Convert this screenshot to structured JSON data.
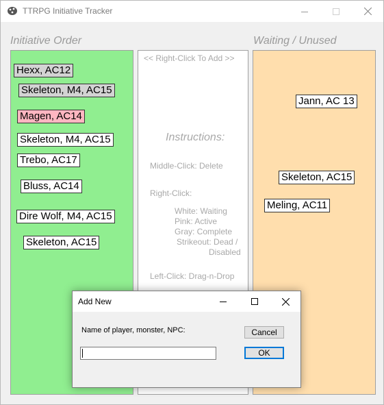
{
  "window": {
    "title": "TTRPG Initiative Tracker",
    "icon": "dice-icon",
    "controls": {
      "minimize": "minimize-icon",
      "maximize": "maximize-icon",
      "close": "close-icon"
    }
  },
  "sections": {
    "initiative_title": "Initiative Order",
    "waiting_title": "Waiting / Unused"
  },
  "initiative": {
    "entries": [
      {
        "label": "Hexx, AC12",
        "state": "Gray: Complete"
      },
      {
        "label": "Skeleton, M4, AC15",
        "state": "Gray: Complete"
      },
      {
        "label": "Magen, AC14",
        "state": "Pink: Active"
      },
      {
        "label": "Skeleton, M4, AC15",
        "state": "White: Waiting"
      },
      {
        "label": "Trebo, AC17",
        "state": "White: Waiting"
      },
      {
        "label": "Bluss, AC14",
        "state": "White: Waiting"
      },
      {
        "label": "Dire Wolf, M4, AC15",
        "state": "White: Waiting"
      },
      {
        "label": "Skeleton, AC15",
        "state": "White: Waiting"
      }
    ]
  },
  "waiting": {
    "entries": [
      {
        "label": "Jann, AC 13"
      },
      {
        "label": "Skeleton, AC15"
      },
      {
        "label": "Meling, AC11"
      }
    ]
  },
  "instructions": {
    "header": "<<   Right-Click To Add   >>",
    "title": "Instructions:",
    "middle_click": "Middle-Click: Delete",
    "right_click": "Right-Click:",
    "white": "White: Waiting",
    "pink": "Pink: Active",
    "gray": "Gray: Complete",
    "strikeout_1": "Strikeout: Dead /",
    "strikeout_2": "Disabled",
    "left_click": "Left-Click: Drag-n-Drop"
  },
  "colors": {
    "initiative_bg": "#90ee90",
    "waiting_bg": "#ffdead",
    "active_pink": "#ffb6c1",
    "complete_gray": "#d3d3d3",
    "default_button_border": "#0078d7"
  },
  "dialog": {
    "title": "Add New",
    "prompt": "Name of player, monster, NPC:",
    "input_value": "",
    "cancel_label": "Cancel",
    "ok_label": "OK"
  }
}
